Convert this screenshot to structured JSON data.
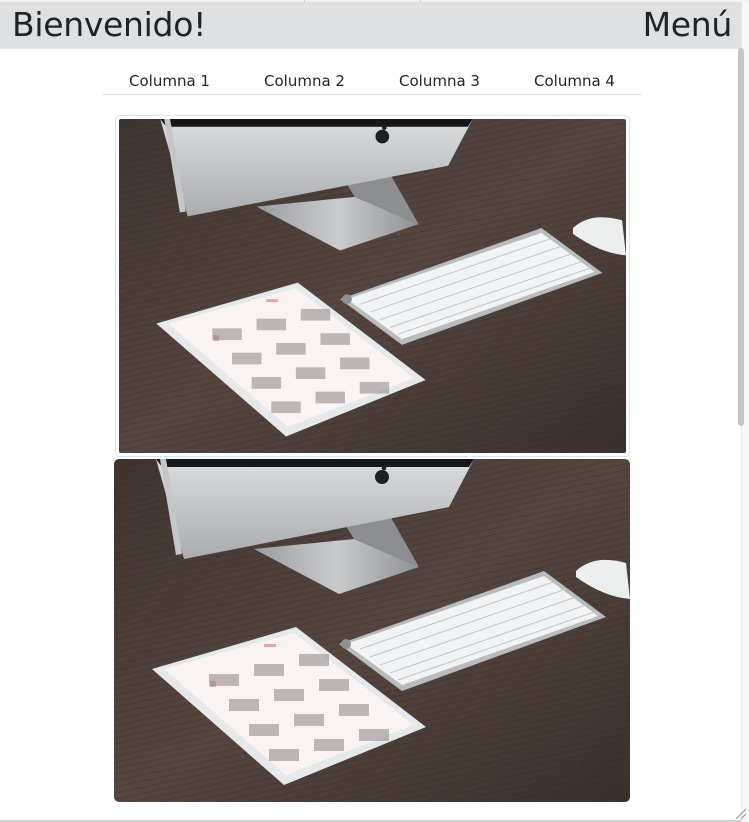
{
  "header": {
    "brand": "Bienvenido!",
    "menu_label": "Menú"
  },
  "nav": {
    "items": [
      {
        "label": "Columna 1"
      },
      {
        "label": "Columna 2"
      },
      {
        "label": "Columna 3"
      },
      {
        "label": "Columna 4"
      }
    ]
  },
  "images": [
    {
      "name": "desk-photo-thumbnail"
    },
    {
      "name": "desk-photo-rounded"
    }
  ],
  "colors": {
    "header_bg": "#dfe0e1",
    "text": "#1f2226",
    "desk": "#4a3c36"
  }
}
